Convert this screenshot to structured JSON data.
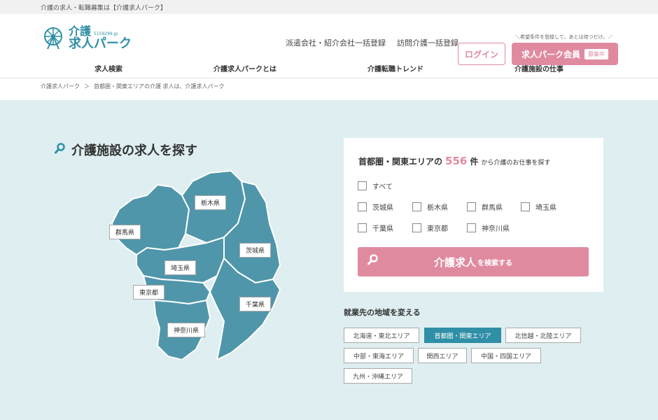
{
  "topbar": {
    "text": "介護の求人・転職募集は【介護求人パーク】"
  },
  "header": {
    "logo": {
      "main": "介護",
      "sub": "求人パーク",
      "small": "5159299.jp"
    },
    "links": [
      "派遣会社・紹介会社一括登録",
      "訪問介護一括登録"
    ],
    "tagline": "＼希望条件を登録して、あとは待つだけ。／",
    "login_label": "ログイン",
    "member_label": "求人パーク会員",
    "member_badge": "募集中"
  },
  "nav": [
    "求人検索",
    "介護求人パークとは",
    "介護転職トレンド",
    "介護施設の仕事"
  ],
  "breadcrumb": [
    "介護求人パーク",
    "＞",
    "首都圏・関東エリアの介護 求人は、介護求人パーク"
  ],
  "section": {
    "title": "介護施設の求人を探す",
    "icon": "search-icon"
  },
  "map": {
    "color": "#4f96aa",
    "labels": [
      "栃木県",
      "群馬県",
      "茨城県",
      "埼玉県",
      "東京都",
      "千葉県",
      "神奈川県"
    ]
  },
  "panel": {
    "title_prefix": "首都圏・関東エリアの",
    "count": "556",
    "count_unit": "件",
    "title_suffix": "から介護のお仕事を探す",
    "all_label": "すべて",
    "prefectures": [
      "茨城県",
      "栃木県",
      "群馬県",
      "埼玉県",
      "千葉県",
      "東京都",
      "神奈川県"
    ],
    "search_main": "介護求人",
    "search_sub": "を検索する"
  },
  "regions": {
    "title": "就業先の地域を変える",
    "items": [
      "北海道・東北エリア",
      "首都圏・関東エリア",
      "北信越・北陸エリア",
      "中部・東海エリア",
      "関西エリア",
      "中国・四国エリア",
      "九州・沖縄エリア"
    ],
    "active_index": 1
  },
  "colors": {
    "accent_pink": "#e08aa0",
    "accent_teal": "#2f8fa6",
    "bg": "#deeef1"
  }
}
